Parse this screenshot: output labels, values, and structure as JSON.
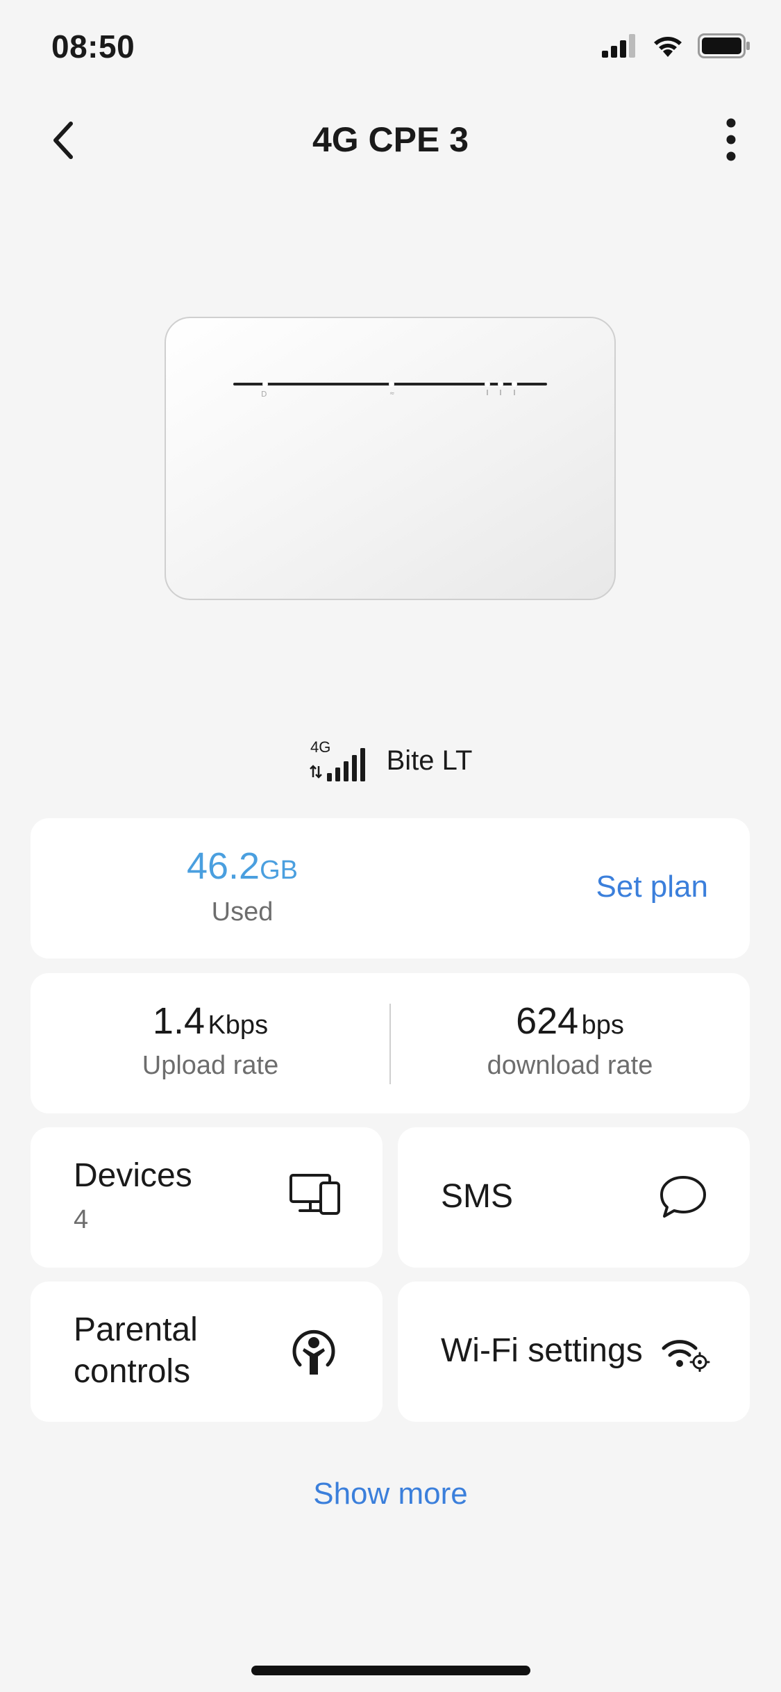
{
  "status_bar": {
    "time": "08:50"
  },
  "nav": {
    "title": "4G CPE 3"
  },
  "network": {
    "type": "4G",
    "carrier": "Bite LT"
  },
  "plan": {
    "used_value": "46.2",
    "used_unit": "GB",
    "used_label": "Used",
    "set_plan_label": "Set plan"
  },
  "rates": {
    "upload_value": "1.4",
    "upload_unit": "Kbps",
    "upload_label": "Upload rate",
    "download_value": "624",
    "download_unit": "bps",
    "download_label": "download rate"
  },
  "tiles": {
    "devices": {
      "label": "Devices",
      "count": "4"
    },
    "sms": {
      "label": "SMS"
    },
    "parental": {
      "label_line1": "Parental",
      "label_line2": "controls"
    },
    "wifi": {
      "label": "Wi-Fi settings"
    }
  },
  "show_more_label": "Show more",
  "colors": {
    "accent": "#3b7fdb",
    "used_value": "#4a9fdf",
    "background": "#f5f5f5",
    "card": "#ffffff"
  },
  "icons": [
    "back-icon",
    "more-vertical-icon",
    "signal-icon",
    "devices-icon",
    "chat-icon",
    "parental-icon",
    "wifi-settings-icon"
  ]
}
